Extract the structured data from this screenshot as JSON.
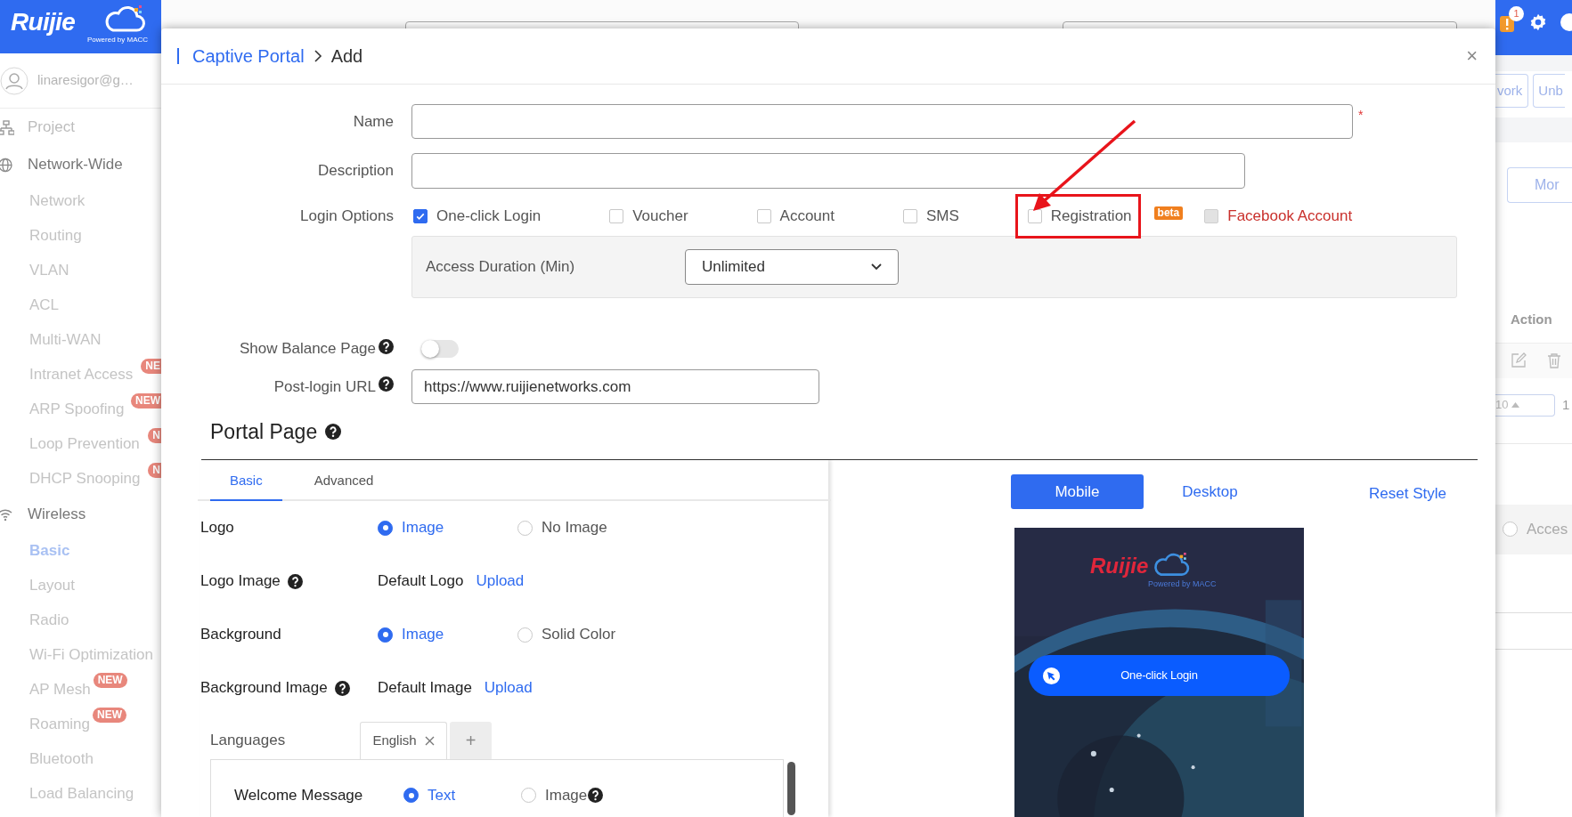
{
  "app": {
    "logo": "Ruijie",
    "tagline": "Powered by MACC",
    "alert_count": "1"
  },
  "user": {
    "email": "linaresigor@g…"
  },
  "sidebar": {
    "items": [
      {
        "label": "Project",
        "expanded": false,
        "selected": false
      },
      {
        "label": "Network-Wide",
        "expanded": true,
        "selected": false,
        "children": [
          {
            "label": "Network",
            "selected": false
          },
          {
            "label": "Routing",
            "selected": false
          },
          {
            "label": "VLAN",
            "selected": false
          },
          {
            "label": "ACL",
            "selected": false
          },
          {
            "label": "Multi-WAN",
            "selected": false
          },
          {
            "label": "Intranet Access",
            "selected": false,
            "badge": {
              "text": "NE",
              "clipped": true
            }
          },
          {
            "label": "ARP Spoofing",
            "selected": false,
            "badge": {
              "text": "NEW",
              "clipped": true
            }
          },
          {
            "label": "Loop Prevention",
            "selected": false,
            "badge": {
              "text": "N",
              "clipped": true
            }
          },
          {
            "label": "DHCP Snooping",
            "selected": false,
            "badge": {
              "text": "N",
              "clipped": true
            }
          }
        ]
      },
      {
        "label": "Wireless",
        "expanded": true,
        "selected": false,
        "children": [
          {
            "label": "Basic",
            "selected": true
          },
          {
            "label": "Layout",
            "selected": false
          },
          {
            "label": "Radio",
            "selected": false
          },
          {
            "label": "Wi-Fi Optimization",
            "selected": false
          },
          {
            "label": "AP Mesh",
            "selected": false,
            "badge": {
              "text": "NEW",
              "clipped": false
            }
          },
          {
            "label": "Roaming",
            "selected": false,
            "badge": {
              "text": "NEW",
              "clipped": false
            }
          },
          {
            "label": "Bluetooth",
            "selected": false
          },
          {
            "label": "Load Balancing",
            "selected": false
          }
        ]
      }
    ]
  },
  "background_page": {
    "toolbar_buttons": [
      "vork",
      "Unb"
    ],
    "more_button": "Mor",
    "column_header": "Action",
    "page_size": "10",
    "page": "1",
    "option": {
      "label": "Acces",
      "selected": false
    }
  },
  "dialog": {
    "breadcrumb": {
      "parent": "Captive Portal",
      "current": "Add"
    },
    "close": "×",
    "required_mark": "*",
    "fields": [
      {
        "label": "Name",
        "required": true
      },
      {
        "label": "Description",
        "required": false
      }
    ],
    "login_options": {
      "label": "Login Options",
      "options": [
        {
          "label": "One-click Login",
          "checked": true,
          "disabled": false,
          "highlighted": false
        },
        {
          "label": "Voucher",
          "checked": false,
          "disabled": false,
          "highlighted": false
        },
        {
          "label": "Account",
          "checked": false,
          "disabled": false,
          "highlighted": false
        },
        {
          "label": "SMS",
          "checked": false,
          "disabled": false,
          "highlighted": false
        },
        {
          "label": "Registration",
          "checked": false,
          "disabled": false,
          "highlighted": true
        },
        {
          "label": "Facebook Account",
          "checked": false,
          "disabled": true,
          "highlighted": false,
          "badge": "beta"
        }
      ]
    },
    "access_duration": {
      "label": "Access Duration (Min)",
      "value": "Unlimited"
    },
    "show_balance": {
      "label": "Show Balance Page",
      "help": true,
      "on": false
    },
    "post_login_url": {
      "label": "Post-login URL",
      "help": true,
      "value": "https://www.ruijienetworks.com"
    },
    "portal_page": {
      "title": "Portal Page",
      "help": true,
      "tabs": [
        {
          "label": "Basic",
          "selected": true
        },
        {
          "label": "Advanced",
          "selected": false
        }
      ],
      "rows": [
        {
          "kind": "radio",
          "label": "Logo",
          "help": false,
          "options": [
            {
              "label": "Image",
              "selected": true
            },
            {
              "label": "No Image",
              "selected": false
            }
          ]
        },
        {
          "kind": "upload",
          "label": "Logo Image",
          "help": true,
          "value": "Default Logo",
          "action": "Upload"
        },
        {
          "kind": "radio",
          "label": "Background",
          "help": false,
          "options": [
            {
              "label": "Image",
              "selected": true
            },
            {
              "label": "Solid Color",
              "selected": false
            }
          ]
        },
        {
          "kind": "upload",
          "label": "Background Image",
          "help": true,
          "value": "Default Image",
          "action": "Upload"
        }
      ],
      "languages": {
        "label": "Languages",
        "tabs": [
          {
            "label": "English",
            "selected": true
          }
        ],
        "add": "+"
      },
      "welcome": {
        "label": "Welcome Message",
        "options": [
          {
            "label": "Text",
            "selected": true,
            "help": false
          },
          {
            "label": "Image",
            "selected": false,
            "help": true
          }
        ]
      }
    },
    "preview": {
      "views": [
        {
          "label": "Mobile",
          "selected": true
        },
        {
          "label": "Desktop",
          "selected": false
        }
      ],
      "reset": "Reset Style",
      "logo": "Ruijie",
      "tagline": "Powered by MACC",
      "login_button": "One-click Login"
    }
  }
}
